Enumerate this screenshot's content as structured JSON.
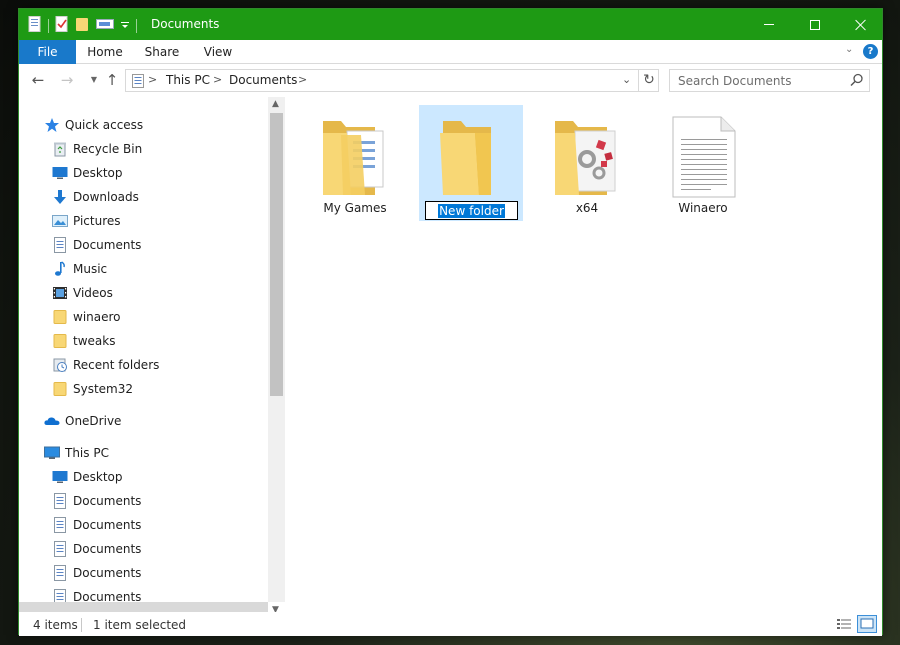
{
  "window": {
    "title": "Documents"
  },
  "titlebar": {
    "quick_access_icons": [
      "properties-icon",
      "checkmark-document-icon",
      "new-folder-icon",
      "rename-icon",
      "customize-toolbar-icon"
    ],
    "controls": [
      "minimize-icon",
      "maximize-icon",
      "close-icon"
    ]
  },
  "ribbon": {
    "tabs": [
      {
        "label": "File",
        "active": true
      },
      {
        "label": "Home"
      },
      {
        "label": "Share"
      },
      {
        "label": "View"
      }
    ],
    "help_label": "?"
  },
  "address": {
    "crumbs": [
      "This PC",
      "Documents"
    ],
    "separator": ">"
  },
  "search": {
    "placeholder": "Search Documents"
  },
  "nav": {
    "quick_access": {
      "label": "Quick access",
      "items": [
        {
          "label": "Recycle Bin",
          "icon": "recycle-bin-icon",
          "pinned": true
        },
        {
          "label": "Desktop",
          "icon": "desktop-icon",
          "pinned": true
        },
        {
          "label": "Downloads",
          "icon": "downloads-icon",
          "pinned": true
        },
        {
          "label": "Pictures",
          "icon": "pictures-icon",
          "pinned": true
        },
        {
          "label": "Documents",
          "icon": "documents-icon",
          "pinned": true
        },
        {
          "label": "Music",
          "icon": "music-icon",
          "pinned": true
        },
        {
          "label": "Videos",
          "icon": "videos-icon",
          "pinned": true
        },
        {
          "label": "winaero",
          "icon": "folder-icon",
          "pinned": true
        },
        {
          "label": "tweaks",
          "icon": "folder-icon",
          "pinned": true
        },
        {
          "label": "Recent folders",
          "icon": "recent-folders-icon",
          "pinned": true
        },
        {
          "label": "System32",
          "icon": "folder-icon",
          "pinned": false
        }
      ]
    },
    "onedrive": {
      "label": "OneDrive"
    },
    "this_pc": {
      "label": "This PC",
      "items": [
        {
          "label": "Desktop",
          "icon": "desktop-icon"
        },
        {
          "label": "Documents",
          "icon": "documents-icon"
        },
        {
          "label": "Documents",
          "icon": "documents-icon"
        },
        {
          "label": "Documents",
          "icon": "documents-icon"
        },
        {
          "label": "Documents",
          "icon": "documents-icon"
        },
        {
          "label": "Documents",
          "icon": "documents-icon"
        }
      ]
    }
  },
  "files": [
    {
      "name": "My Games",
      "type": "folder-with-documents",
      "selected": false
    },
    {
      "name": "New folder",
      "type": "empty-folder",
      "selected": true,
      "renaming": true
    },
    {
      "name": "x64",
      "type": "folder-with-settings",
      "selected": false
    },
    {
      "name": "Winaero",
      "type": "text-document",
      "selected": false
    }
  ],
  "status": {
    "item_count": "4 items",
    "selection": "1 item selected"
  },
  "colors": {
    "titlebar": "#1e9a14",
    "file_tab": "#1979ca",
    "selection": "#cce8ff",
    "rename_highlight": "#0078d7",
    "folder": "#f8d775"
  }
}
